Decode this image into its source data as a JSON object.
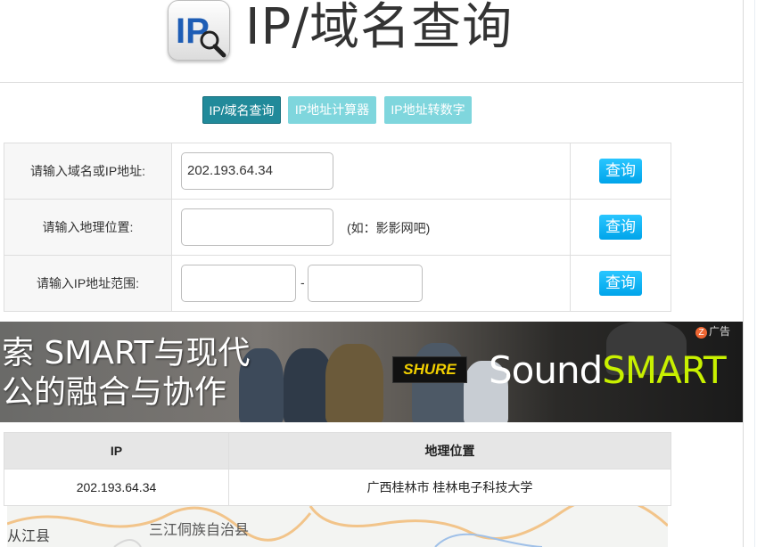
{
  "header": {
    "title": "IP/域名查询",
    "logo_icon": "ip-magnifier-icon"
  },
  "tabs": [
    {
      "label": "IP/域名查询",
      "active": true
    },
    {
      "label": "IP地址计算器",
      "active": false
    },
    {
      "label": "IP地址转数字",
      "active": false
    }
  ],
  "query": {
    "row1": {
      "label": "请输入域名或IP地址:",
      "value": "202.193.64.34",
      "button": "查询"
    },
    "row2": {
      "label": "请输入地理位置:",
      "value": "",
      "hint": "(如：影影网吧)",
      "button": "查询"
    },
    "row3": {
      "label": "请输入IP地址范围:",
      "start": "",
      "separator": "-",
      "end": "",
      "button": "查询"
    }
  },
  "ad": {
    "line1": "索 SMART与现代",
    "line2": "公的融合与协作",
    "shure": "SHURE",
    "brand_prefix": "Sound",
    "brand_suffix": "SMART",
    "tag": "广告"
  },
  "results": {
    "headers": [
      "IP",
      "地理位置"
    ],
    "rows": [
      [
        "202.193.64.34",
        "广西桂林市 桂林电子科技大学"
      ]
    ]
  },
  "map": {
    "labels": [
      "从江县",
      "三江侗族自治县"
    ]
  },
  "colors": {
    "tab_active": "#218a9a",
    "tab_inactive": "#7fd6dd",
    "button": "#00a4ea"
  }
}
